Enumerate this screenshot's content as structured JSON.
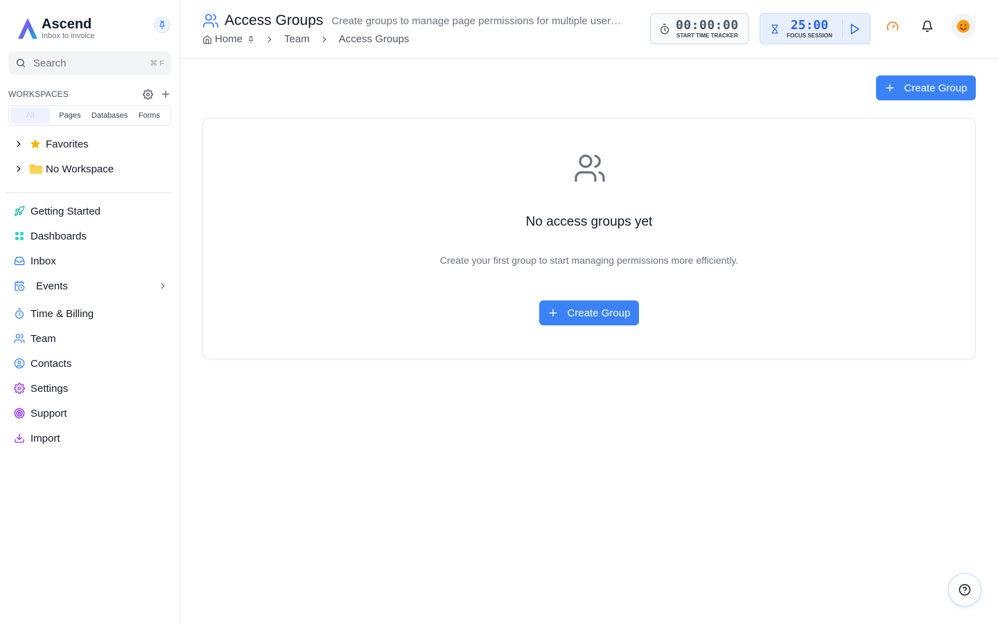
{
  "brand": {
    "name": "Ascend",
    "tagline": "Inbox to invoice"
  },
  "search": {
    "label": "Search",
    "shortcut": "⌘ F"
  },
  "workspaces": {
    "title": "WORKSPACES",
    "filters": [
      "All",
      "Pages",
      "Databases",
      "Forms"
    ],
    "active_filter": "All",
    "tree": [
      {
        "label": "Favorites",
        "icon": "star-icon"
      },
      {
        "label": "No Workspace",
        "icon": "folder-icon"
      }
    ]
  },
  "nav": {
    "items": [
      {
        "label": "Getting Started",
        "icon": "rocket-icon"
      },
      {
        "label": "Dashboards",
        "icon": "grid-icon"
      },
      {
        "label": "Inbox",
        "icon": "inbox-icon"
      },
      {
        "label": "Events",
        "icon": "calendar-clock-icon"
      },
      {
        "label": "Time & Billing",
        "icon": "stopwatch-icon"
      },
      {
        "label": "Team",
        "icon": "users-icon"
      },
      {
        "label": "Contacts",
        "icon": "user-circle-icon"
      },
      {
        "label": "Settings",
        "icon": "gear-icon"
      },
      {
        "label": "Support",
        "icon": "lifebuoy-icon"
      },
      {
        "label": "Import",
        "icon": "download-icon"
      }
    ]
  },
  "header": {
    "title": "Access Groups",
    "description": "Create groups to manage page permissions for multiple users at once",
    "breadcrumb": [
      "Home",
      "Team",
      "Access Groups"
    ]
  },
  "timer": {
    "value": "00:00:00",
    "label": "START TIME TRACKER"
  },
  "focus": {
    "value": "25:00",
    "label": "FOCUS SESSION"
  },
  "main": {
    "create_button": "Create Group",
    "empty_title": "No access groups yet",
    "empty_description": "Create your first group to start managing permissions more efficiently.",
    "empty_button": "Create Group"
  },
  "colors": {
    "primary": "#3b82f6",
    "accent_orange": "#f97316",
    "border": "#e5e7eb"
  }
}
